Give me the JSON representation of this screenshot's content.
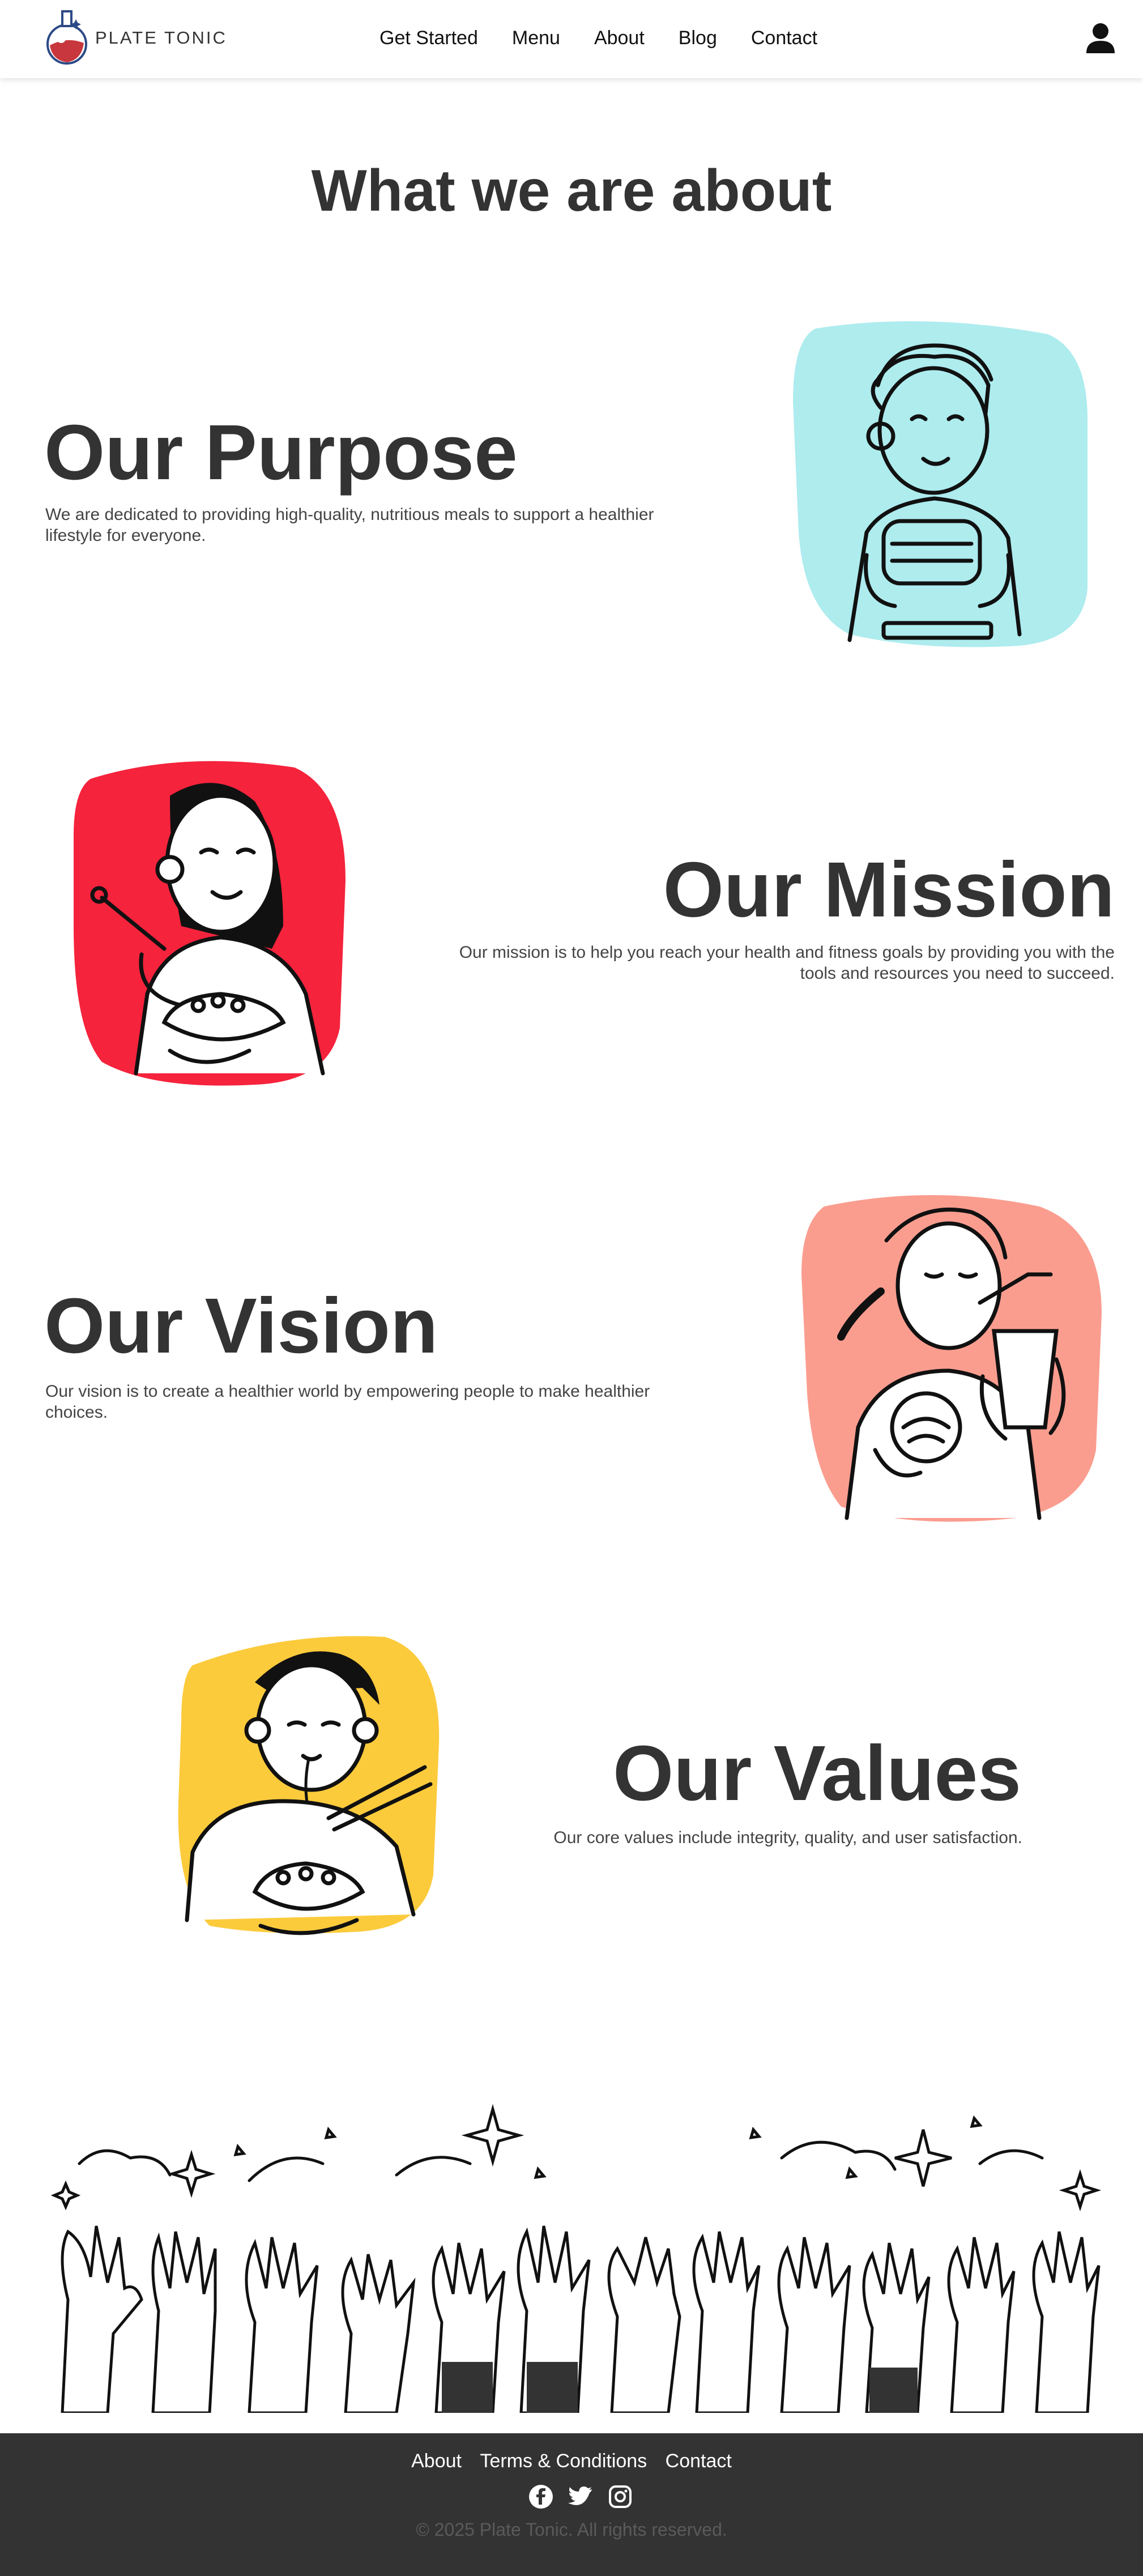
{
  "brand": {
    "name": "PLATE TONIC"
  },
  "nav": {
    "items": [
      {
        "label": "Get Started"
      },
      {
        "label": "Menu"
      },
      {
        "label": "About"
      },
      {
        "label": "Blog"
      },
      {
        "label": "Contact"
      }
    ]
  },
  "page": {
    "title": "What we are about"
  },
  "sections": [
    {
      "heading": "Our Purpose",
      "text": "We are dedicated to providing high-quality, nutritious meals to support a healthier lifestyle for everyone.",
      "blob_color": "#aeecee",
      "illustration": "boy-eating-sandwich"
    },
    {
      "heading": "Our Mission",
      "text": "Our mission is to help you reach your health and fitness goals by providing you with the tools and resources you need to succeed.",
      "blob_color": "#f5233c",
      "illustration": "woman-eating-bowl"
    },
    {
      "heading": "Our Vision",
      "text": "Our vision is to create a healthier world by empowering people to make healthier choices.",
      "blob_color": "#fa9d8f",
      "illustration": "woman-drinking-smoothie"
    },
    {
      "heading": "Our Values",
      "text": "Our core values include integrity, quality, and user satisfaction.",
      "blob_color": "#fccb3c",
      "illustration": "man-eating-noodles"
    }
  ],
  "footer": {
    "links": [
      {
        "label": "About"
      },
      {
        "label": "Terms & Conditions"
      },
      {
        "label": "Contact"
      }
    ],
    "social": [
      "facebook-icon",
      "twitter-icon",
      "instagram-icon"
    ],
    "copyright": "© 2025 Plate Tonic. All rights reserved."
  },
  "colors": {
    "brand_red": "#c8373d",
    "brand_blue": "#2c4a86",
    "footer_bg": "#333333",
    "text": "#333333"
  }
}
